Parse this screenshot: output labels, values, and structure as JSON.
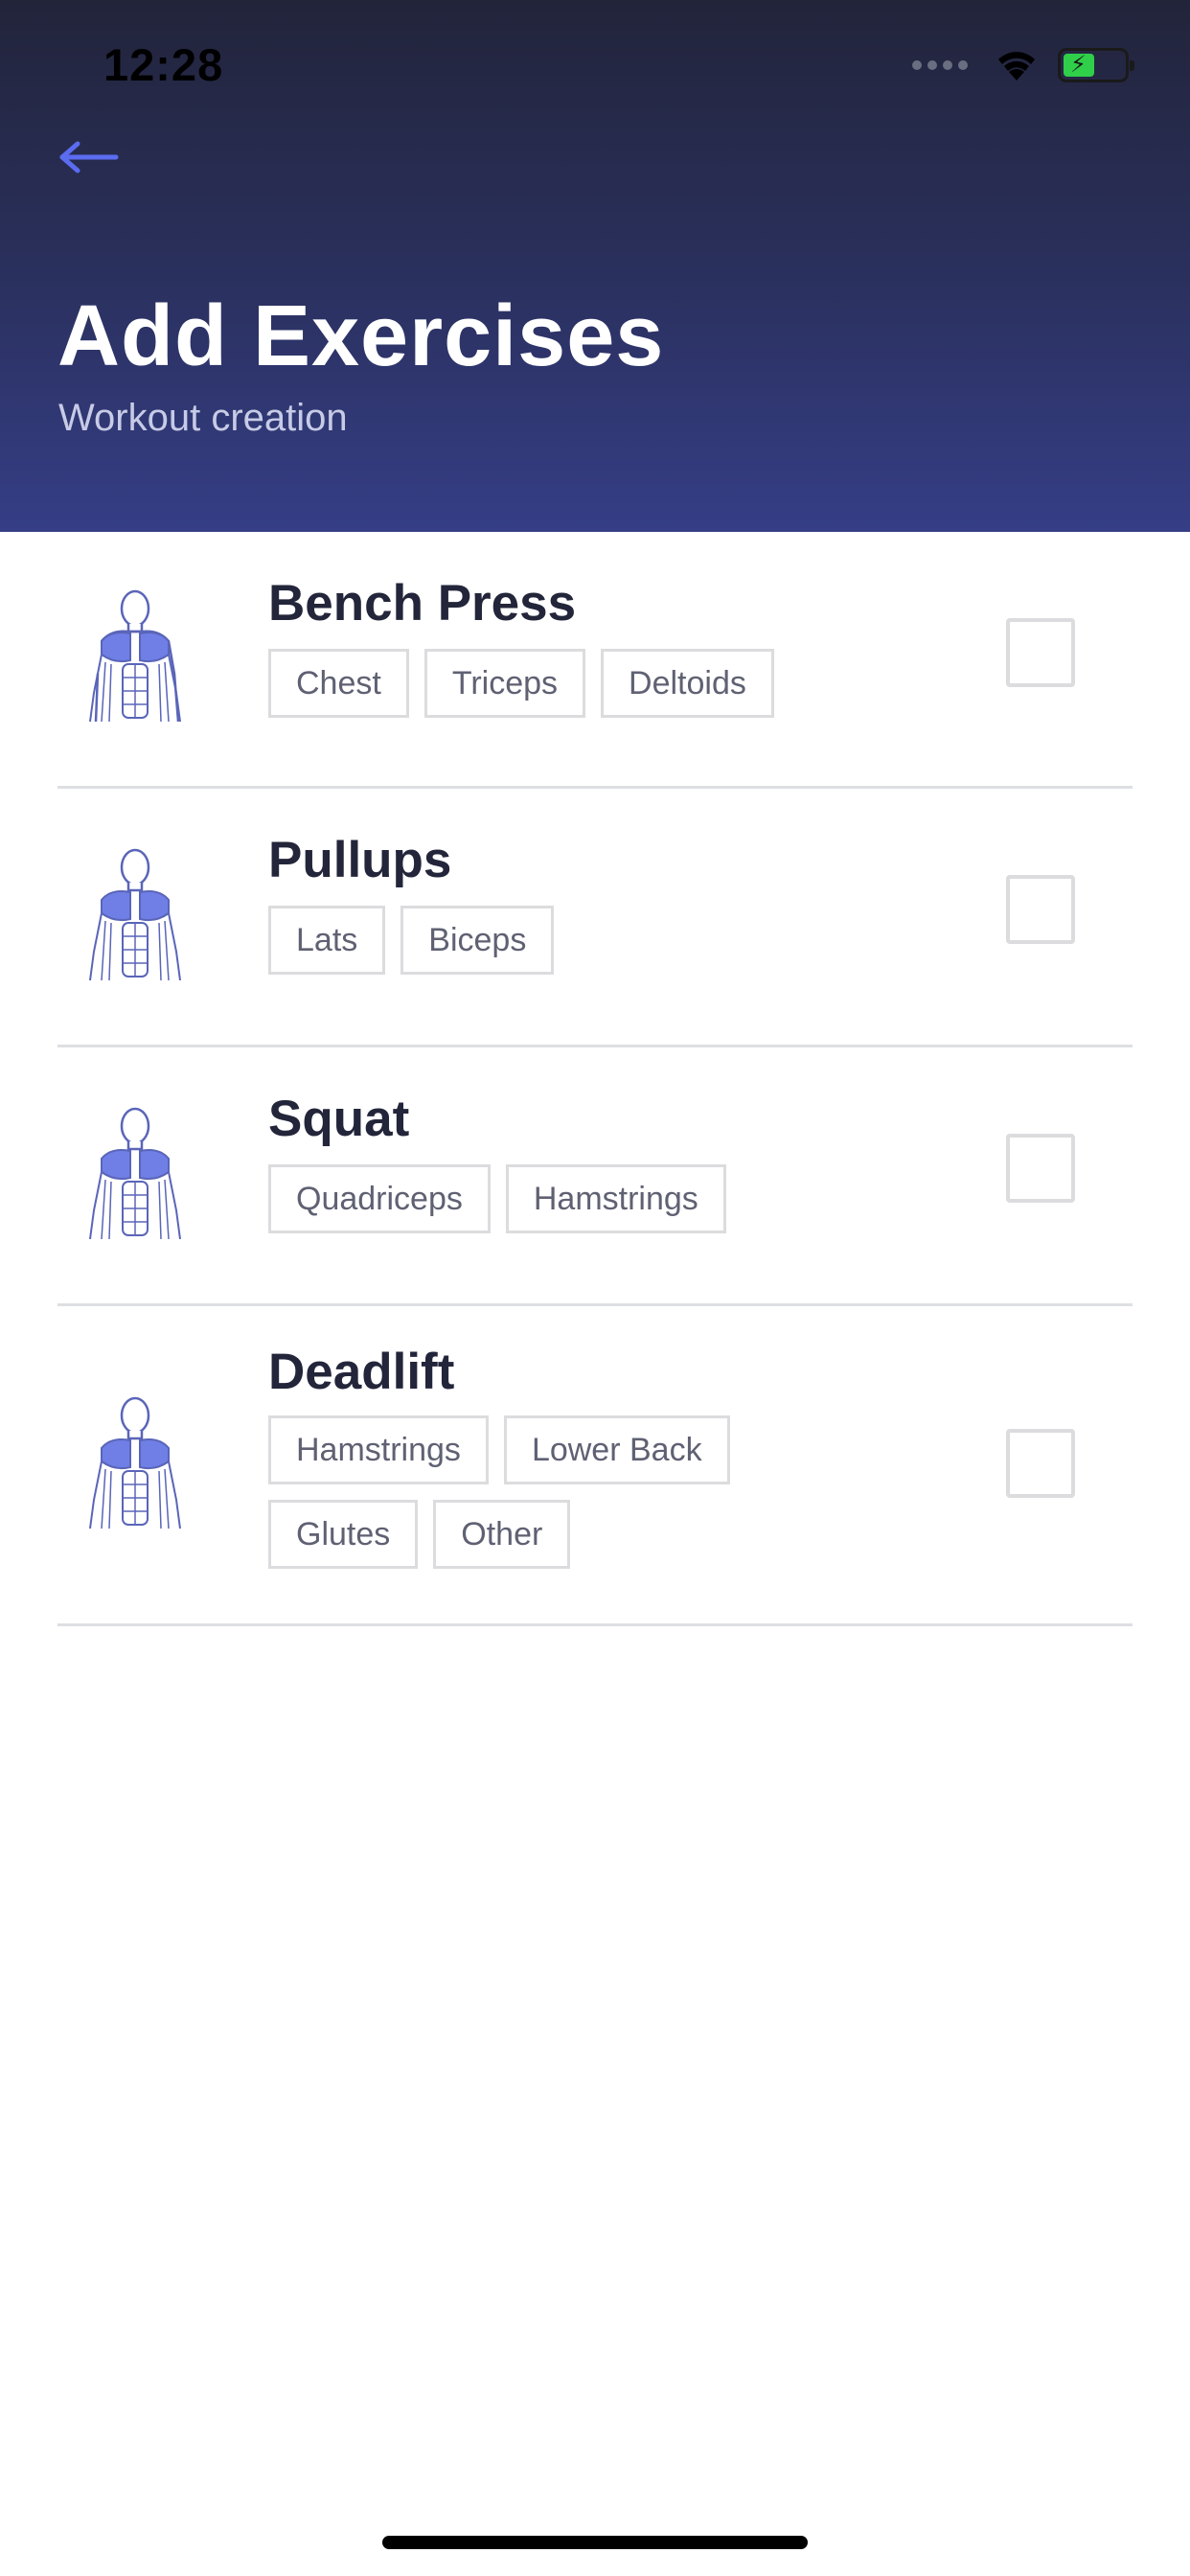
{
  "status_bar": {
    "time": "12:28",
    "icons": [
      "signal-icon",
      "wifi-icon",
      "battery-charging-icon"
    ]
  },
  "header": {
    "back_icon": "arrow-left-icon",
    "title": "Add Exercises",
    "subtitle": "Workout creation",
    "accent_color": "#5b6cf0"
  },
  "exercises": [
    {
      "name": "Bench Press",
      "tags": [
        "Chest",
        "Triceps",
        "Deltoids"
      ],
      "checked": false
    },
    {
      "name": "Pullups",
      "tags": [
        "Lats",
        "Biceps"
      ],
      "checked": false
    },
    {
      "name": "Squat",
      "tags": [
        "Quadriceps",
        "Hamstrings"
      ],
      "checked": false
    },
    {
      "name": "Deadlift",
      "tags": [
        "Hamstrings",
        "Lower Back",
        "Glutes",
        "Other"
      ],
      "checked": false
    }
  ]
}
